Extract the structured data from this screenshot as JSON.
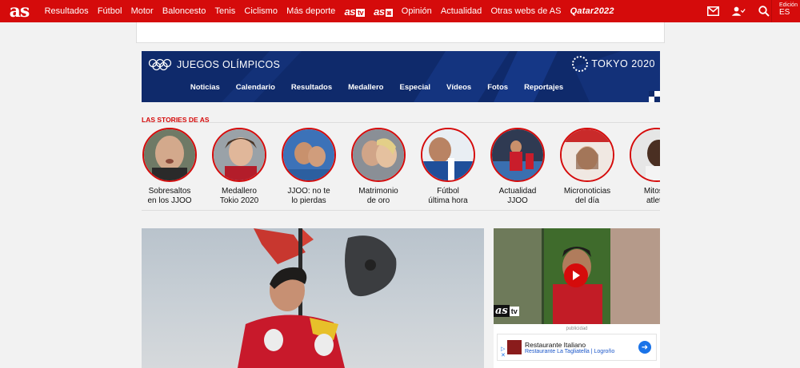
{
  "topbar": {
    "logo": "as",
    "nav": [
      "Resultados",
      "Fútbol",
      "Motor",
      "Baloncesto",
      "Tenis",
      "Ciclismo",
      "Más deporte"
    ],
    "brand_tv": {
      "as": "as",
      "tv": "tv"
    },
    "brand_foto": {
      "as": "as",
      "tv": "◙"
    },
    "nav2": [
      "Opinión",
      "Actualidad",
      "Otras webs de AS"
    ],
    "qatar": "Qatar2022",
    "edition_label": "Edición",
    "edition_code": "ES",
    "icons": [
      "mail-icon",
      "user-icon",
      "search-icon"
    ]
  },
  "olympics": {
    "title": "JUEGOS OLÍMPICOS",
    "event": "TOKYO 2020",
    "menu": [
      "Noticias",
      "Calendario",
      "Resultados",
      "Medallero",
      "Especial",
      "Vídeos",
      "Fotos",
      "Reportajes"
    ],
    "bg_color": "#0f2a6b"
  },
  "stories": {
    "heading": "LAS STORIES DE AS",
    "items": [
      {
        "caption1": "Sobresaltos",
        "caption2": "en los JJOO"
      },
      {
        "caption1": "Medallero",
        "caption2": "Tokio 2020"
      },
      {
        "caption1": "JJOO: no te",
        "caption2": "lo pierdas"
      },
      {
        "caption1": "Matrimonio",
        "caption2": "de oro"
      },
      {
        "caption1": "Fútbol",
        "caption2": "última hora"
      },
      {
        "caption1": "Actualidad",
        "caption2": "JJOO"
      },
      {
        "caption1": "Micronoticias",
        "caption2": "del día"
      },
      {
        "caption1": "Mitos d",
        "caption2": "atletis"
      }
    ]
  },
  "video": {
    "as": "as",
    "tv": "tv"
  },
  "ad": {
    "label": "publicidad",
    "title": "Restaurante Italiano",
    "subtitle": "Restaurante La Tagliatella | Logroño"
  },
  "colors": {
    "accent": "#d50b0b",
    "olympic_blue": "#0f2a6b"
  }
}
